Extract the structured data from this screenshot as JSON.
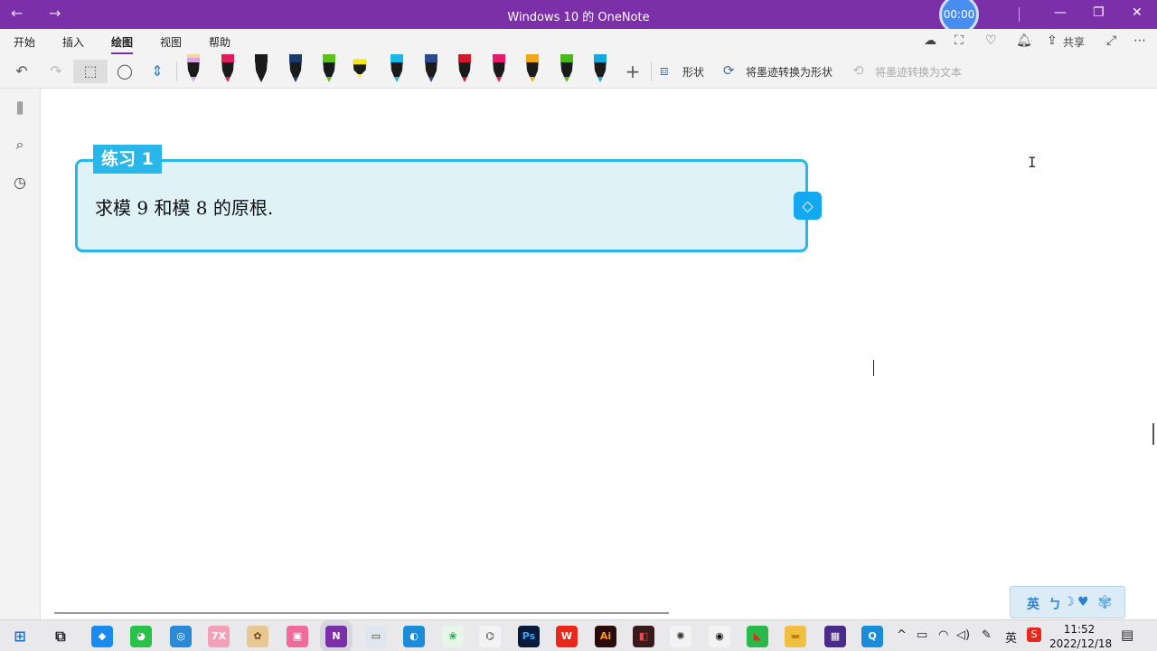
{
  "window": {
    "title": "Windows 10 的 OneNote",
    "back": "←",
    "forward": "→",
    "timer": "00:00",
    "minimize": "—",
    "restore": "❐",
    "close": "✕"
  },
  "menu": {
    "tabs": [
      "开始",
      "插入",
      "绘图",
      "视图",
      "帮助"
    ],
    "active_tab": "绘图",
    "share_label": "共享"
  },
  "toolbar": {
    "undo": "↶",
    "redo": "↷",
    "lasso": "⬚",
    "eraser": "◯",
    "space": "⇕",
    "add_pen": "+",
    "shapes_label": "形状",
    "ink_to_shape_label": "将墨迹转换为形状",
    "ink_to_text_label": "将墨迹转换为文本",
    "pens": [
      {
        "name": "pen-pink-lavender",
        "color": "#d8a6e8",
        "cap": "#f0d8a0"
      },
      {
        "name": "pen-red",
        "color": "#e01e5a",
        "cap": "#e01e5a"
      },
      {
        "name": "pen-black",
        "color": "#1a1a1a",
        "cap": "#1a1a1a"
      },
      {
        "name": "pen-navy",
        "color": "#1a3a6a",
        "cap": "#1a3a6a"
      },
      {
        "name": "pen-green",
        "color": "#5ac21a",
        "cap": "#5ac21a"
      },
      {
        "name": "highlighter-yellow",
        "color": "#f5e61c",
        "cap": "#f5e61c"
      },
      {
        "name": "pen-cyan",
        "color": "#1ab8e8",
        "cap": "#1ab8e8"
      },
      {
        "name": "pen-blue-dark",
        "color": "#2a4a8a",
        "cap": "#2a4a8a"
      },
      {
        "name": "pen-crimson",
        "color": "#d01828",
        "cap": "#d01828"
      },
      {
        "name": "pen-magenta",
        "color": "#e8186a",
        "cap": "#e8186a"
      },
      {
        "name": "pen-amber",
        "color": "#f0a81a",
        "cap": "#f0a81a"
      },
      {
        "name": "pen-lime",
        "color": "#4ab81a",
        "cap": "#4ab81a"
      },
      {
        "name": "pen-sky",
        "color": "#18a8e0",
        "cap": "#18a8e0"
      }
    ]
  },
  "sidebar": {
    "icons": [
      "notebooks-icon",
      "search-icon",
      "recent-icon"
    ]
  },
  "page": {
    "exercise_label": "练习 1",
    "exercise_text": "求模 9 和模 8 的原根.",
    "ime_label": "英"
  },
  "taskbar": {
    "apps": [
      {
        "name": "windows-start-icon",
        "glyph": "⊞",
        "bg": "transparent",
        "fg": "#1a73d8"
      },
      {
        "name": "task-view-icon",
        "glyph": "⧉",
        "bg": "transparent",
        "fg": "#222"
      },
      {
        "name": "pin-app-icon",
        "glyph": "◆",
        "bg": "#1a8cf0",
        "fg": "#fff"
      },
      {
        "name": "wechat-icon",
        "glyph": "◕",
        "bg": "#2ac24a",
        "fg": "#fff"
      },
      {
        "name": "target-app-icon",
        "glyph": "◎",
        "bg": "#2a8ad8",
        "fg": "#fff"
      },
      {
        "name": "7zip-icon",
        "glyph": "7X",
        "bg": "#f2a0b8",
        "fg": "#fff"
      },
      {
        "name": "paint-icon",
        "glyph": "✿",
        "bg": "#e8c890",
        "fg": "#6a4a20"
      },
      {
        "name": "bilibili-icon",
        "glyph": "▣",
        "bg": "#f06a9a",
        "fg": "#fff"
      },
      {
        "name": "onenote-icon",
        "glyph": "N",
        "bg": "#7b2fa8",
        "fg": "#fff"
      },
      {
        "name": "remote-desktop-icon",
        "glyph": "▭",
        "bg": "#dfe6ee",
        "fg": "#333"
      },
      {
        "name": "edge-icon",
        "glyph": "◐",
        "bg": "#1a8cd8",
        "fg": "#fff"
      },
      {
        "name": "flower-app-icon",
        "glyph": "❀",
        "bg": "#e8f6ea",
        "fg": "#2aa84a"
      },
      {
        "name": "geogebra-icon",
        "glyph": "⌬",
        "bg": "#f3f3f3",
        "fg": "#333"
      },
      {
        "name": "photoshop-icon",
        "glyph": "Ps",
        "bg": "#0a1a3a",
        "fg": "#31a8ff"
      },
      {
        "name": "wps-icon",
        "glyph": "W",
        "bg": "#e8281a",
        "fg": "#fff"
      },
      {
        "name": "illustrator-icon",
        "glyph": "Ai",
        "bg": "#2a0a0a",
        "fg": "#ff9a00"
      },
      {
        "name": "video-editor-icon",
        "glyph": "◧",
        "bg": "#3a1a1a",
        "fg": "#e84a4a"
      },
      {
        "name": "settings-app-icon",
        "glyph": "✺",
        "bg": "#f3f3f3",
        "fg": "#333"
      },
      {
        "name": "qq-icon",
        "glyph": "◉",
        "bg": "#f3f3f3",
        "fg": "#111"
      },
      {
        "name": "mindmap-icon",
        "glyph": "◣",
        "bg": "#2ab84a",
        "fg": "#e8281a"
      },
      {
        "name": "file-explorer-icon",
        "glyph": "▬",
        "bg": "#f0c040",
        "fg": "#c08010"
      },
      {
        "name": "media-player-icon",
        "glyph": "▦",
        "bg": "#4a2a8a",
        "fg": "#fff"
      },
      {
        "name": "search-app-icon",
        "glyph": "Q",
        "bg": "#1a8cd8",
        "fg": "#fff"
      }
    ],
    "tray": {
      "chevron": "^",
      "ime": "英",
      "time": "11:52",
      "date": "2022/12/18"
    }
  }
}
